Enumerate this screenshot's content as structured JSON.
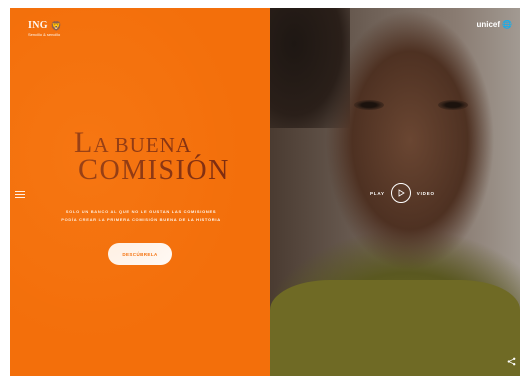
{
  "brand": {
    "name": "ING",
    "lion_glyph": "🦁",
    "tagline": "Sencillo & sencillo"
  },
  "hero": {
    "title_line1_initial": "L",
    "title_line1_rest": "A BUENA",
    "title_line2_initial": "C",
    "title_line2_rest": "OMISIÓN",
    "subtitle_line1": "SOLO UN BANCO AL QUE NO LE GUSTAN LAS COMISIONES",
    "subtitle_line2": "PODÍA CREAR LA PRIMERA COMISIÓN BUENA DE LA HISTORIA",
    "cta_label": "DESCÚBRELA"
  },
  "partner": {
    "name": "unicef",
    "globe_glyph": "🌐"
  },
  "video": {
    "play_label": "PLAY",
    "video_label": "VIDEO"
  },
  "icons": {
    "menu": "menu-icon",
    "play": "play-icon",
    "share": "share-icon"
  },
  "colors": {
    "brand_orange": "#f36f0b",
    "title_brown": "#7a2a10"
  }
}
